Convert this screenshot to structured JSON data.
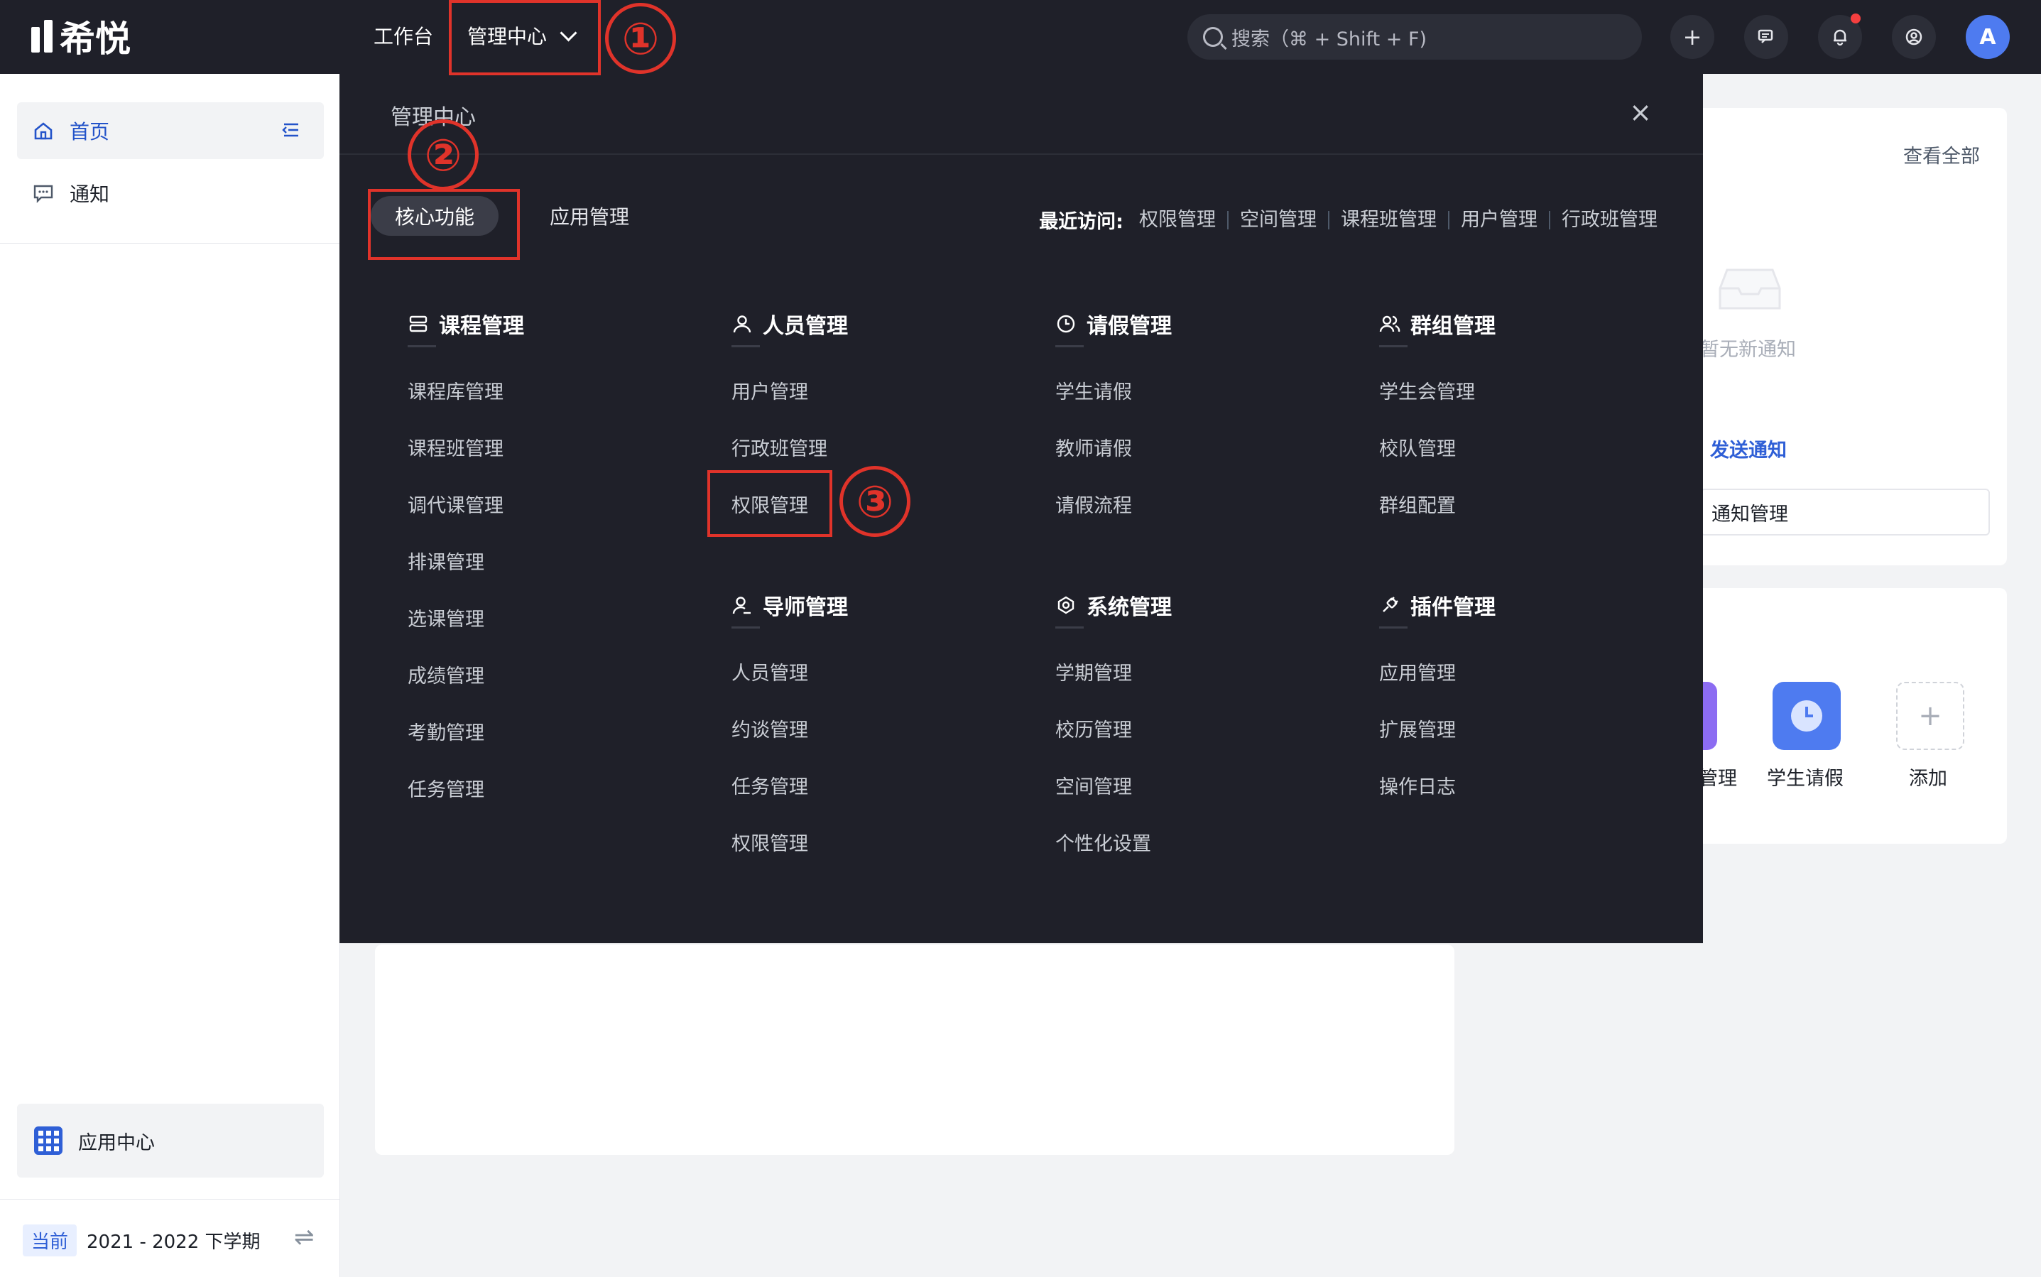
{
  "topbar": {
    "logo_text": "希悦",
    "nav_workbench": "工作台",
    "nav_manage": "管理中心",
    "search_placeholder": "搜索（⌘ + Shift + F)",
    "avatar_letter": "A"
  },
  "sidebar": {
    "items": [
      {
        "label": "首页"
      },
      {
        "label": "通知"
      }
    ],
    "app_center": "应用中心",
    "term_tag": "当前",
    "term_label": "2021 - 2022 下学期"
  },
  "right_panel": {
    "view_all": "查看全部",
    "no_notice": "暂无新通知",
    "send_notice": "发送通知",
    "notice_manage": "通知管理",
    "apps": [
      {
        "label": "管理",
        "color": "#8c6cf2"
      },
      {
        "label": "学生请假",
        "color": "#4e7bf0"
      },
      {
        "label": "添加"
      }
    ]
  },
  "dropdown": {
    "title": "管理中心",
    "tabs": [
      "核心功能",
      "应用管理"
    ],
    "recent_title": "最近访问:",
    "recent_links": [
      "权限管理",
      "空间管理",
      "课程班管理",
      "用户管理",
      "行政班管理"
    ],
    "categories": [
      {
        "title": "课程管理",
        "icon": "course-icon",
        "items": [
          "课程库管理",
          "课程班管理",
          "调代课管理",
          "排课管理",
          "选课管理",
          "成绩管理",
          "考勤管理",
          "任务管理"
        ]
      },
      {
        "title": "人员管理",
        "icon": "person-icon",
        "items": [
          "用户管理",
          "行政班管理",
          "权限管理"
        ]
      },
      {
        "title": "请假管理",
        "icon": "clock-icon",
        "items": [
          "学生请假",
          "教师请假",
          "请假流程"
        ]
      },
      {
        "title": "群组管理",
        "icon": "group-icon",
        "items": [
          "学生会管理",
          "校队管理",
          "群组配置"
        ]
      },
      {
        "title": "导师管理",
        "icon": "mentor-icon",
        "items": [
          "人员管理",
          "约谈管理",
          "任务管理",
          "权限管理"
        ]
      },
      {
        "title": "系统管理",
        "icon": "system-icon",
        "items": [
          "学期管理",
          "校历管理",
          "空间管理",
          "个性化设置"
        ]
      },
      {
        "title": "插件管理",
        "icon": "plugin-icon",
        "items": [
          "应用管理",
          "扩展管理",
          "操作日志"
        ]
      }
    ]
  },
  "annotations": [
    "①",
    "②",
    "③"
  ],
  "colors": {
    "topbar_bg": "#1f2029",
    "accent": "#2f5fd6",
    "annotation_red": "#e0332a"
  }
}
